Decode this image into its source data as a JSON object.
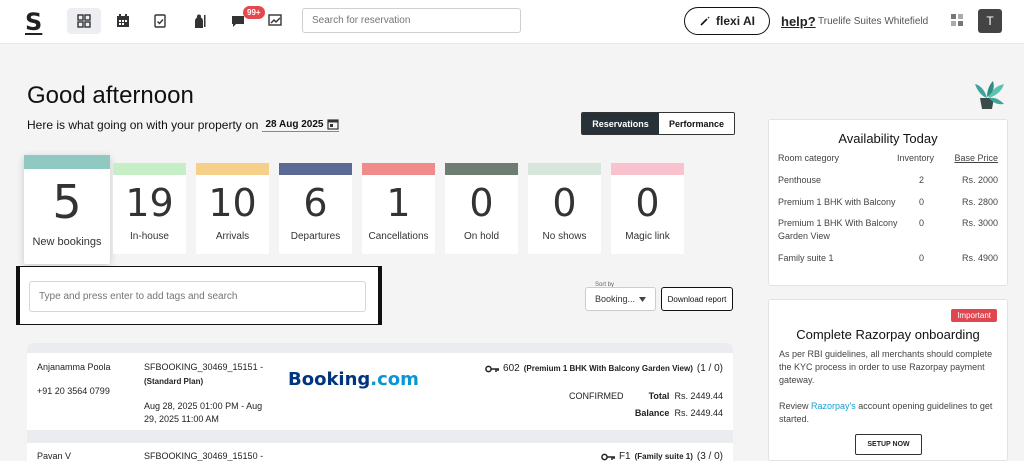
{
  "nav": {
    "logo": "S",
    "badge": "99+",
    "search_placeholder": "Search for reservation",
    "flexi_label": "flexi AI",
    "help_label": "help?",
    "property_name": "Truelife Suites Whitefield",
    "avatar_initial": "T"
  },
  "header": {
    "greeting": "Good afternoon",
    "subline": "Here is what going on with your property on",
    "date": "28 Aug 2025",
    "toggle": {
      "active": "Reservations",
      "inactive": "Performance"
    }
  },
  "stats": [
    {
      "value": "5",
      "label": "New bookings",
      "color": "#8fc9c2"
    },
    {
      "value": "19",
      "label": "In-house",
      "color": "#c6efc8"
    },
    {
      "value": "10",
      "label": "Arrivals",
      "color": "#f6cf8a"
    },
    {
      "value": "6",
      "label": "Departures",
      "color": "#5b6a94"
    },
    {
      "value": "1",
      "label": "Cancellations",
      "color": "#ef8b8b"
    },
    {
      "value": "0",
      "label": "On hold",
      "color": "#6e7c74"
    },
    {
      "value": "0",
      "label": "No shows",
      "color": "#d6e6dd"
    },
    {
      "value": "0",
      "label": "Magic link",
      "color": "#f8c3cf"
    }
  ],
  "filters": {
    "tag_placeholder": "Type and press enter to add tags and search",
    "sort_label": "Sort by",
    "sort_value": "Booking...",
    "download_label": "Download report"
  },
  "reservations": [
    {
      "guest": "Anjanamma Poola",
      "phone": "+91 20 3564 0799",
      "booking_id": "SFBOOKING_30469_15151 -",
      "plan": "(Standard Plan)",
      "dates": "Aug 28, 2025 01:00 PM - Aug 29, 2025 11:00 AM",
      "source_main": "Booking",
      "source_suffix": ".com",
      "room_no": "602",
      "room_type": "(Premium 1 BHK With Balcony Garden View)",
      "room_count": "(1 / 0)",
      "status": "CONFIRMED",
      "total_label": "Total",
      "total": "Rs. 2449.44",
      "balance_label": "Balance",
      "balance": "Rs. 2449.44"
    },
    {
      "guest": "Pavan V",
      "booking_id": "SFBOOKING_30469_15150 -",
      "room_no": "F1",
      "room_type": "(Family suite 1)",
      "room_count": "(3 / 0)"
    }
  ],
  "availability": {
    "title": "Availability Today",
    "headers": {
      "category": "Room category",
      "inventory": "Inventory",
      "price": "Base Price"
    },
    "rows": [
      {
        "category": "Penthouse",
        "inventory": "2",
        "price": "Rs. 2000"
      },
      {
        "category": "Premium 1 BHK with Balcony",
        "inventory": "0",
        "price": "Rs. 2800"
      },
      {
        "category": "Premium 1 BHK With Balcony Garden View",
        "inventory": "0",
        "price": "Rs. 3000"
      },
      {
        "category": "Family suite 1",
        "inventory": "0",
        "price": "Rs. 4900"
      }
    ]
  },
  "razorpay": {
    "badge": "Important",
    "title": "Complete Razorpay onboarding",
    "description": "As per RBI guidelines, all merchants should complete the KYC process in order to use Razorpay payment gateway.",
    "review_prefix": "Review",
    "review_link": "Razorpay's",
    "review_suffix": "account opening guidelines to get started.",
    "button": "SETUP NOW"
  }
}
